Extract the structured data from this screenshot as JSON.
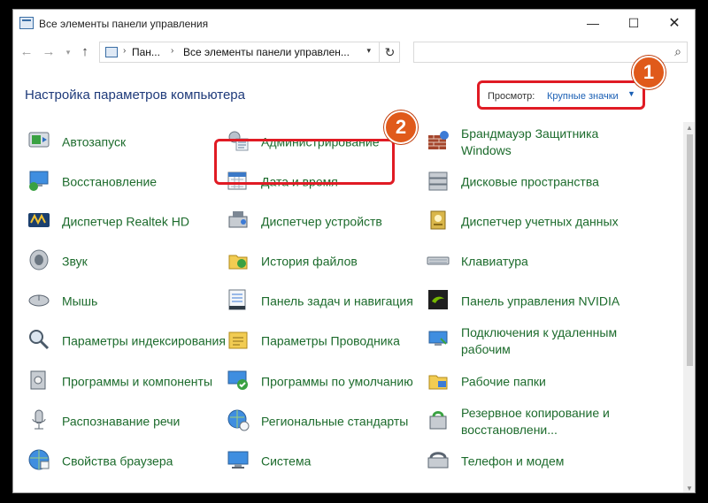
{
  "window": {
    "title": "Все элементы панели управления",
    "controls": {
      "minimize": "—",
      "maximize": "☐",
      "close": "✕"
    }
  },
  "nav": {
    "back": "←",
    "forward": "→",
    "recent": "▾",
    "up": "↑",
    "crumbs": [
      "Пан...",
      "Все элементы панели управлен..."
    ],
    "crumb_sep": "›",
    "dropdown": "▾",
    "refresh": "↻",
    "search_icon": "⌕",
    "search_placeholder": ""
  },
  "header": {
    "title": "Настройка параметров компьютера",
    "view_label": "Просмотр:",
    "view_value": "Крупные значки",
    "view_caret": "▼"
  },
  "callouts": {
    "one": "1",
    "two": "2"
  },
  "items": [
    {
      "label": "Автозапуск",
      "icon": "autoplay-icon"
    },
    {
      "label": "Администрирование",
      "icon": "admin-tools-icon"
    },
    {
      "label": "Брандмауэр Защитника Windows",
      "icon": "firewall-icon"
    },
    {
      "label": "Восстановление",
      "icon": "recovery-icon"
    },
    {
      "label": "Дата и время",
      "icon": "calendar-clock-icon"
    },
    {
      "label": "Дисковые пространства",
      "icon": "storage-spaces-icon"
    },
    {
      "label": "Диспетчер Realtek HD",
      "icon": "realtek-audio-icon"
    },
    {
      "label": "Диспетчер устройств",
      "icon": "device-manager-icon"
    },
    {
      "label": "Диспетчер учетных данных",
      "icon": "credential-manager-icon"
    },
    {
      "label": "Звук",
      "icon": "speaker-icon"
    },
    {
      "label": "История файлов",
      "icon": "file-history-icon"
    },
    {
      "label": "Клавиатура",
      "icon": "keyboard-icon"
    },
    {
      "label": "Мышь",
      "icon": "mouse-icon"
    },
    {
      "label": "Панель задач и навигация",
      "icon": "taskbar-icon"
    },
    {
      "label": "Панель управления NVIDIA",
      "icon": "nvidia-icon"
    },
    {
      "label": "Параметры индексирования",
      "icon": "indexing-icon"
    },
    {
      "label": "Параметры Проводника",
      "icon": "explorer-options-icon"
    },
    {
      "label": "Подключения к удаленным рабочим",
      "icon": "remote-desktop-icon"
    },
    {
      "label": "Программы и компоненты",
      "icon": "programs-features-icon"
    },
    {
      "label": "Программы по умолчанию",
      "icon": "default-programs-icon"
    },
    {
      "label": "Рабочие папки",
      "icon": "work-folders-icon"
    },
    {
      "label": "Распознавание речи",
      "icon": "microphone-icon"
    },
    {
      "label": "Региональные стандарты",
      "icon": "globe-clock-icon"
    },
    {
      "label": "Резервное копирование и восстановлени...",
      "icon": "backup-icon"
    },
    {
      "label": "Свойства браузера",
      "icon": "browser-globe-icon"
    },
    {
      "label": "Система",
      "icon": "monitor-icon"
    },
    {
      "label": "Телефон и модем",
      "icon": "phone-modem-icon"
    }
  ],
  "colors": {
    "item_text": "#1c6b2c",
    "heading": "#1e3a7a",
    "link": "#1a5fb4",
    "highlight": "#e01b24",
    "badge": "#e05a1b"
  }
}
